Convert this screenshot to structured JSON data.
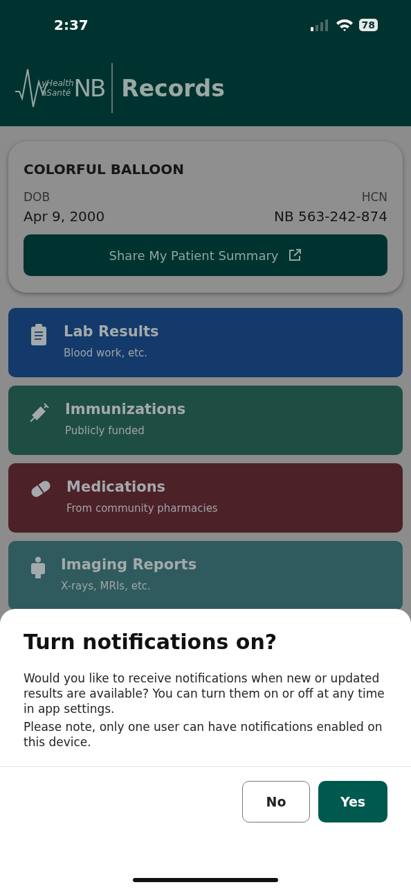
{
  "status_bar": {
    "time": "2:37",
    "battery": "78"
  },
  "header": {
    "logo_small_top": "yHealth",
    "logo_small_bottom": "aSanté",
    "logo_big": "NB",
    "title": "Records"
  },
  "patient": {
    "name": "COLORFUL BALLOON",
    "dob_label": "DOB",
    "dob": "Apr 9, 2000",
    "hcn_label": "HCN",
    "hcn": "NB 563-242-874",
    "share_button": "Share My Patient Summary"
  },
  "categories": [
    {
      "kind": "lab",
      "title": "Lab Results",
      "subtitle": "Blood work, etc.",
      "color": "#133a6a"
    },
    {
      "kind": "vaccine",
      "title": "Immunizations",
      "subtitle": "Publicly funded",
      "color": "#1e4d44"
    },
    {
      "kind": "pill",
      "title": "Medications",
      "subtitle": "From community pharmacies",
      "color": "#4d2128"
    },
    {
      "kind": "imaging",
      "title": "Imaging Reports",
      "subtitle": "X-rays, MRIs, etc.",
      "color": "#2f5b5e"
    }
  ],
  "dialog": {
    "title": "Turn notifications on?",
    "paragraphs": [
      "Would you like to receive notifications when new or updated results are available? You can turn them on or off at any time in app settings.",
      "Please note, only one user can have notifications enabled on this device."
    ],
    "buttons": [
      {
        "label": "No",
        "kind": "secondary"
      },
      {
        "label": "Yes",
        "kind": "primary"
      }
    ]
  }
}
